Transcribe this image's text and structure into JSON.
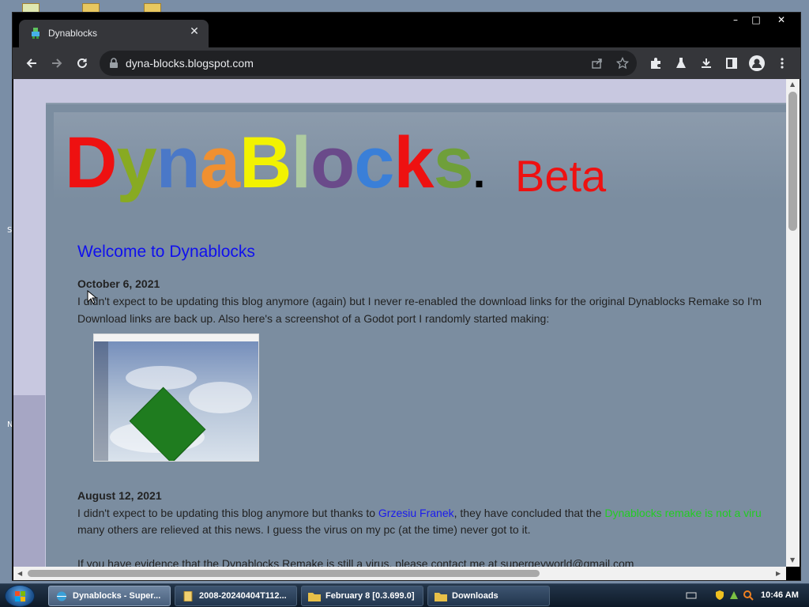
{
  "browser": {
    "tab_title": "Dynablocks",
    "tab_close": "✕",
    "url": "dyna-blocks.blogspot.com",
    "window_controls": {
      "minimize": "–",
      "maximize": "□",
      "close": "✕"
    }
  },
  "blog": {
    "logo_letters": [
      {
        "char": "D",
        "color": "#ee1111"
      },
      {
        "char": "y",
        "color": "#88aa22"
      },
      {
        "char": "n",
        "color": "#4a78c8"
      },
      {
        "char": "a",
        "color": "#f09030"
      },
      {
        "char": "B",
        "color": "#f2f200"
      },
      {
        "char": "l",
        "color": "#aecba0"
      },
      {
        "char": "o",
        "color": "#6a4a8a"
      },
      {
        "char": "c",
        "color": "#3a7fd8"
      },
      {
        "char": "k",
        "color": "#ee1111"
      },
      {
        "char": "s",
        "color": "#6f9f3a"
      }
    ],
    "logo_dot": ".",
    "logo_beta": "Beta",
    "post_title": "Welcome to Dynablocks",
    "post1": {
      "date": "October 6, 2021",
      "line1": "I didn't expect to be updating this blog anymore (again) but I never re-enabled the download links for the original Dynablocks Remake so I'm",
      "line2": "Download links are back up. Also here's a screenshot of a Godot port I randomly started making:"
    },
    "post2": {
      "date": "August 12, 2021",
      "line1_a": "I didn't expect to be updating this blog anymore but thanks to ",
      "line1_link": "Grzesiu Franek",
      "line1_b": ", they have concluded that the ",
      "line1_green": "Dynablocks remake is not a viru",
      "line2": "many others are relieved at this news. I guess the virus on my pc (at the time) never got to it.",
      "line3": "If you have evidence that the Dynablocks Remake is still a virus, please contact me at supergeyworld@gmail.com"
    }
  },
  "taskbar": {
    "tasks": [
      {
        "label": "Dynablocks - Super...",
        "active": true
      },
      {
        "label": "2008-20240404T112...",
        "active": false
      },
      {
        "label": "February 8 [0.3.699.0]",
        "active": false
      },
      {
        "label": "Downloads",
        "active": false
      }
    ],
    "clock": "10:46 AM"
  }
}
